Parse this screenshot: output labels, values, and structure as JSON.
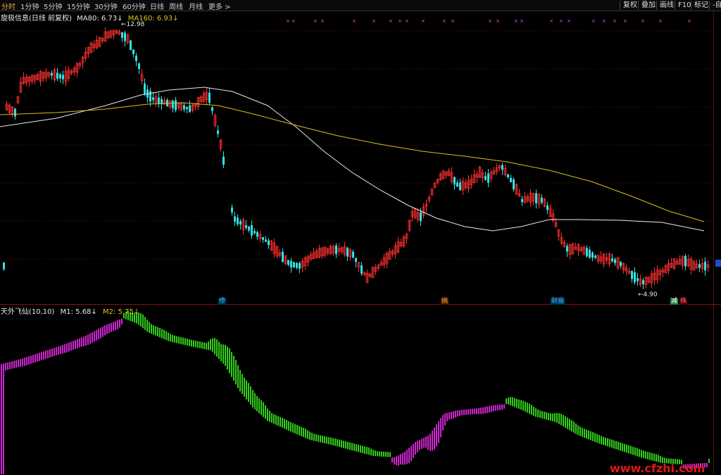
{
  "toolbar": {
    "periods": [
      {
        "label": "分时",
        "active": true
      },
      {
        "label": "1分钟"
      },
      {
        "label": "5分钟"
      },
      {
        "label": "15分钟"
      },
      {
        "label": "30分钟"
      },
      {
        "label": "60分钟"
      },
      {
        "label": "日线"
      },
      {
        "label": "周线"
      },
      {
        "label": "月线"
      },
      {
        "label": "更多 >"
      }
    ],
    "right_buttons": [
      "复权",
      "叠加",
      "画线",
      "F10",
      "标记",
      "-自选"
    ]
  },
  "info": {
    "name": "旋极信息(日线 前复权)",
    "ma80": "MA80: 6.73↓",
    "ma160": "MA160: 6.93↓"
  },
  "annotations": {
    "high_label": "12.98",
    "low_label": "4.90"
  },
  "markers": [
    {
      "char": "停",
      "color": "#30c0ff",
      "bg": "#003050"
    },
    {
      "char": "摘",
      "color": "#ff9030",
      "bg": "#402000"
    },
    {
      "char": "财报",
      "color": "#30c0ff",
      "bg": "#003050"
    },
    {
      "char": "减",
      "color": "#ffffff",
      "bg": "#208040"
    },
    {
      "char": "株",
      "color": "#ff6060",
      "bg": "#500000"
    }
  ],
  "indicator": {
    "name": "天外飞仙(10,10)",
    "m1": "M1: 5.68↓",
    "m2": "M2: 5.75↓"
  },
  "watermark": "www.cfzhi.com",
  "colors": {
    "up": "#ff3030",
    "down": "#30e0e0",
    "ma80": "#e8e8e8",
    "ma160": "#d8c020",
    "ind_up": "#ff30ff",
    "ind_down": "#40ff20",
    "grid": "#6a0a0a"
  }
}
